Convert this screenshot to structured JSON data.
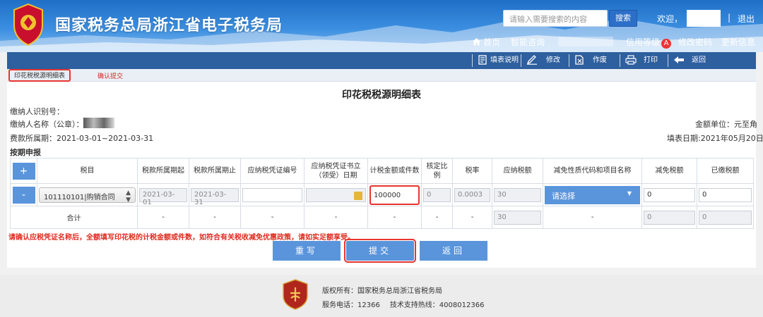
{
  "header": {
    "brand_title": "国家税务总局浙江省电子税务局",
    "search_placeholder": "请输入需要搜索的内容",
    "search_label": "搜索",
    "welcome": "欢迎，",
    "separator": "|",
    "logout": "退出",
    "nav": {
      "home": "首页",
      "smart": "智能咨询",
      "credit": "信用等级",
      "credit_badge": "A",
      "change_pwd": "修改密码",
      "update_info": "更新信息"
    }
  },
  "toolbar": {
    "fill_guide": "填表说明",
    "edit": "修改",
    "void": "作废",
    "print": "打印",
    "back": "返回"
  },
  "tabs": {
    "current": "印花税税源明细表",
    "next": "确认提交"
  },
  "form": {
    "title": "印花税税源明细表",
    "taxpayer_id_label": "缴纳人识别号：",
    "taxpayer_name_label": "缴纳人名称（公章）：",
    "period_label": "费款所属期：",
    "period_value": "2021-03-01~2021-03-31",
    "unit_label": "金额单位：",
    "unit_value": "元至角",
    "fill_date_label": "填表日期:",
    "fill_date_value": "2021年05月20日",
    "section_label": "按期申报"
  },
  "table": {
    "headers": {
      "add": "+",
      "tax_item": "税目",
      "start": "税款所属期起",
      "end": "税款所属期止",
      "voucher_no": "应纳税凭证编号",
      "voucher_date": "应纳税凭证书立（领受）日期",
      "amount": "计税金额或件数",
      "ratio": "核定比例",
      "rate": "税率",
      "payable": "应纳税额",
      "relief_code": "减免性质代码和项目名称",
      "relief_amount": "减免税额",
      "paid": "已缴税额"
    },
    "row": {
      "remove": "-",
      "tax_item": "101110101|购销合同",
      "start": "2021-03-01",
      "end": "2021-03-31",
      "voucher_no": "",
      "voucher_date": "",
      "amount": "100000",
      "ratio": "0",
      "rate": "0.0003",
      "payable": "30",
      "relief_code": "请选择",
      "relief_amount": "0",
      "paid": "0"
    },
    "total": {
      "label": "合计",
      "dash": "-",
      "payable": "30",
      "relief_amount": "0",
      "paid": "0"
    }
  },
  "warning": "请确认应税凭证名称后，全额填写印花税的计税金额或件数，如符合有关税收减免优惠政策，请如实足额享受。",
  "actions": {
    "reset": "重写",
    "submit": "提交",
    "back": "返回"
  },
  "footer": {
    "copyright": "版权所有：国家税务总局浙江省税务局",
    "service": "服务电话：12366",
    "support": "技术支持热线：4008012366"
  },
  "colors": {
    "header_blue": "#2e6fc4",
    "toolbar_blue": "#2e5f9e",
    "button_blue": "#5a95dc",
    "highlight_red": "#e8352f",
    "warning_red": "#e02a1f"
  }
}
